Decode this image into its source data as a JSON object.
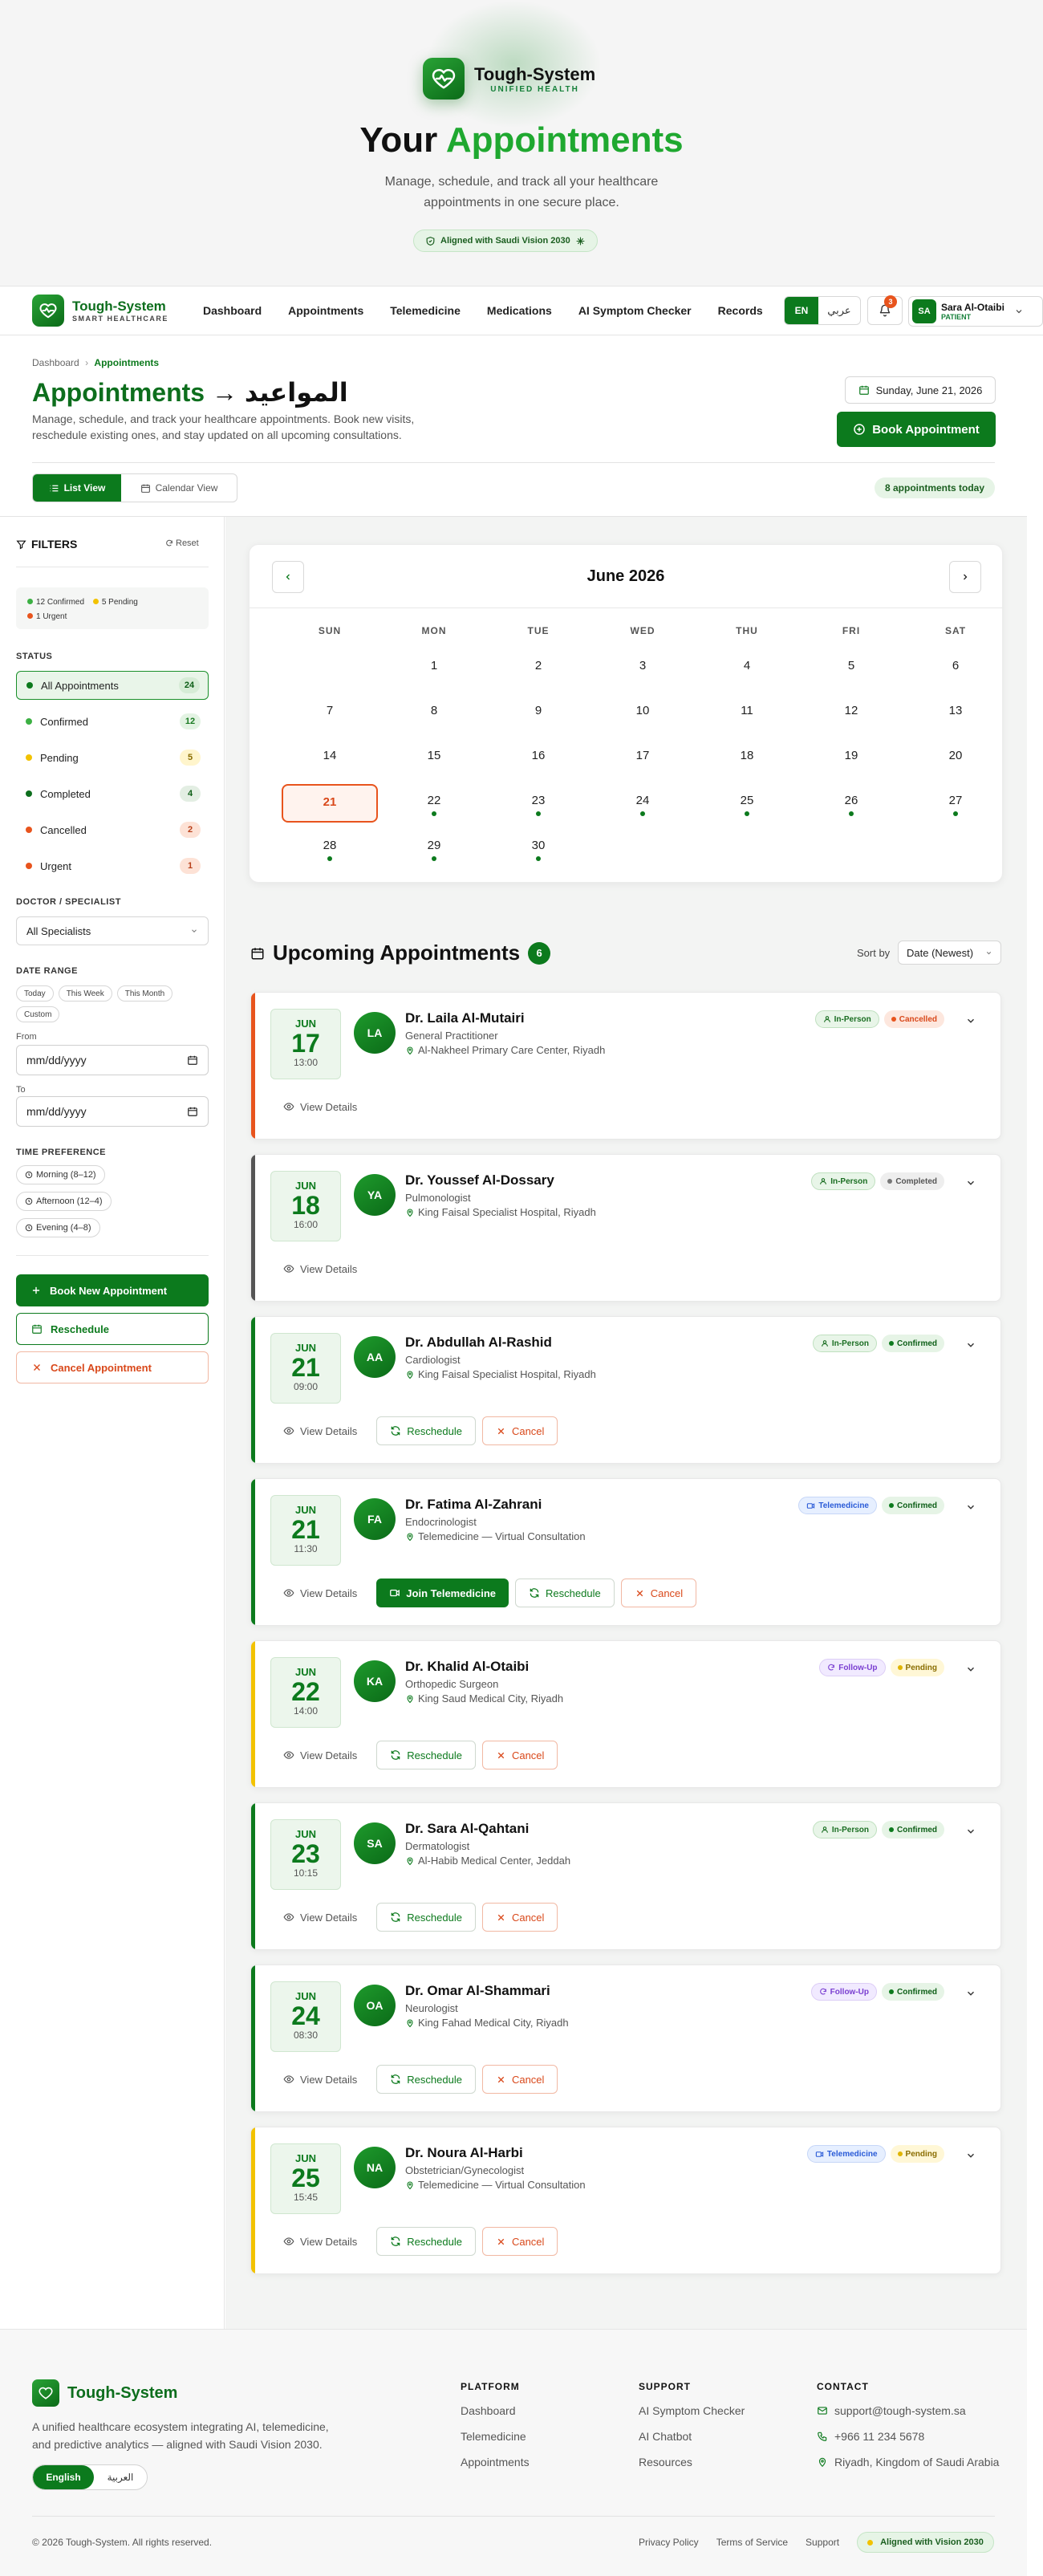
{
  "brand": {
    "name": "Tough-System",
    "tagline_hero": "UNIFIED HEALTH",
    "tagline_nav": "SMART HEALTHCARE",
    "accent": "#0c7a1d"
  },
  "hero": {
    "title_prefix": "Your ",
    "title_accent": "Appointments",
    "subtitle": "Manage, schedule, and track all your healthcare appointments in one secure place.",
    "vision_badge": "Aligned with Saudi Vision 2030"
  },
  "nav": {
    "links": [
      "Dashboard",
      "Appointments",
      "Telemedicine",
      "Medications",
      "AI Symptom Checker",
      "Records"
    ],
    "lang_en": "EN",
    "lang_ar": "عربي",
    "notif_count": "3",
    "user_initials": "SA",
    "user_name": "Sara Al-Otaibi",
    "user_role": "PATIENT"
  },
  "page": {
    "breadcrumb_root": "Dashboard",
    "breadcrumb_current": "Appointments",
    "title_en": "Appointments",
    "title_arrow": " → ",
    "title_ar": "المواعيد",
    "description": "Manage, schedule, and track your healthcare appointments. Book new visits, reschedule existing ones, and stay updated on all upcoming consultations.",
    "current_date": "Sunday, June 21, 2026",
    "book_button": "Book Appointment",
    "view_list": "List View",
    "view_calendar": "Calendar View",
    "today_count": "8 appointments today"
  },
  "sidebar": {
    "title": "FILTERS",
    "reset": "Reset",
    "summary_confirmed": "12 Confirmed",
    "summary_pending": "5 Pending",
    "summary_urgent": "1 Urgent",
    "status_label": "STATUS",
    "statuses": [
      {
        "label": "All Appointments",
        "count": "24",
        "dot": "#0c7a1d",
        "badge_bg": "#d6ecd6",
        "badge_fg": "#0c5e16"
      },
      {
        "label": "Confirmed",
        "count": "12",
        "dot": "#3cb043",
        "badge_bg": "#e3f3e3",
        "badge_fg": "#1a7a22"
      },
      {
        "label": "Pending",
        "count": "5",
        "dot": "#f2c200",
        "badge_bg": "#fff5cc",
        "badge_fg": "#8a6d00"
      },
      {
        "label": "Completed",
        "count": "4",
        "dot": "#0d6e1d",
        "badge_bg": "#e3eee3",
        "badge_fg": "#0d5e16"
      },
      {
        "label": "Cancelled",
        "count": "2",
        "dot": "#e8541d",
        "badge_bg": "#fde2d6",
        "badge_fg": "#b8401a"
      },
      {
        "label": "Urgent",
        "count": "1",
        "dot": "#e8541d",
        "badge_bg": "#fde2d6",
        "badge_fg": "#b8401a"
      }
    ],
    "doctor_label": "DOCTOR / SPECIALIST",
    "doctor_value": "All Specialists",
    "date_range_label": "DATE RANGE",
    "date_chips": [
      "Today",
      "This Week",
      "This Month",
      "Custom"
    ],
    "from_label": "From",
    "to_label": "To",
    "date_placeholder": "mm/dd/yyyy",
    "time_label": "TIME PREFERENCE",
    "time_chips": [
      "Morning (8–12)",
      "Afternoon (12–4)",
      "Evening (4–8)"
    ],
    "btn_book": "Book New Appointment",
    "btn_reschedule": "Reschedule",
    "btn_cancel": "Cancel Appointment"
  },
  "calendar": {
    "title": "June 2026",
    "weekdays": [
      "SUN",
      "MON",
      "TUE",
      "WED",
      "THU",
      "FRI",
      "SAT"
    ],
    "first_weekday": 1,
    "days_in_month": 30,
    "today": 21,
    "appointment_days": [
      22,
      23,
      24,
      25,
      26,
      27,
      28,
      29,
      30
    ]
  },
  "upcoming": {
    "title": "Upcoming Appointments",
    "count": "6",
    "sort_label": "Sort by",
    "sort_value": "Date (Newest)",
    "view_details": "View Details",
    "reschedule": "Reschedule",
    "cancel": "Cancel",
    "join": "Join Telemedicine",
    "items": [
      {
        "month": "JUN",
        "day": "17",
        "time": "13:00",
        "initials": "LA",
        "doctor": "Dr. Laila Al-Mutairi",
        "specialty": "General Practitioner",
        "location": "Al-Nakheel Primary Care Center, Riyadh",
        "type": "In-Person",
        "status": "Cancelled",
        "bar": "#e8541d",
        "actions": [
          "view"
        ]
      },
      {
        "month": "JUN",
        "day": "18",
        "time": "16:00",
        "initials": "YA",
        "doctor": "Dr. Youssef Al-Dossary",
        "specialty": "Pulmonologist",
        "location": "King Faisal Specialist Hospital, Riyadh",
        "type": "In-Person",
        "status": "Completed",
        "bar": "#555555",
        "actions": [
          "view"
        ]
      },
      {
        "month": "JUN",
        "day": "21",
        "time": "09:00",
        "initials": "AA",
        "doctor": "Dr. Abdullah Al-Rashid",
        "specialty": "Cardiologist",
        "location": "King Faisal Specialist Hospital, Riyadh",
        "type": "In-Person",
        "status": "Confirmed",
        "bar": "#0c7a1d",
        "actions": [
          "view",
          "reschedule",
          "cancel"
        ]
      },
      {
        "month": "JUN",
        "day": "21",
        "time": "11:30",
        "initials": "FA",
        "doctor": "Dr. Fatima Al-Zahrani",
        "specialty": "Endocrinologist",
        "location": "Telemedicine — Virtual Consultation",
        "type": "Telemedicine",
        "status": "Confirmed",
        "bar": "#0c7a1d",
        "actions": [
          "view",
          "join",
          "reschedule",
          "cancel"
        ]
      },
      {
        "month": "JUN",
        "day": "22",
        "time": "14:00",
        "initials": "KA",
        "doctor": "Dr. Khalid Al-Otaibi",
        "specialty": "Orthopedic Surgeon",
        "location": "King Saud Medical City, Riyadh",
        "type": "Follow-Up",
        "status": "Pending",
        "bar": "#f2c200",
        "actions": [
          "view",
          "reschedule",
          "cancel"
        ]
      },
      {
        "month": "JUN",
        "day": "23",
        "time": "10:15",
        "initials": "SA",
        "doctor": "Dr. Sara Al-Qahtani",
        "specialty": "Dermatologist",
        "location": "Al-Habib Medical Center, Jeddah",
        "type": "In-Person",
        "status": "Confirmed",
        "bar": "#0c7a1d",
        "actions": [
          "view",
          "reschedule",
          "cancel"
        ]
      },
      {
        "month": "JUN",
        "day": "24",
        "time": "08:30",
        "initials": "OA",
        "doctor": "Dr. Omar Al-Shammari",
        "specialty": "Neurologist",
        "location": "King Fahad Medical City, Riyadh",
        "type": "Follow-Up",
        "status": "Confirmed",
        "bar": "#0c7a1d",
        "actions": [
          "view",
          "reschedule",
          "cancel"
        ]
      },
      {
        "month": "JUN",
        "day": "25",
        "time": "15:45",
        "initials": "NA",
        "doctor": "Dr. Noura Al-Harbi",
        "specialty": "Obstetrician/Gynecologist",
        "location": "Telemedicine — Virtual Consultation",
        "type": "Telemedicine",
        "status": "Pending",
        "bar": "#f2c200",
        "actions": [
          "view",
          "reschedule",
          "cancel"
        ]
      }
    ]
  },
  "footer": {
    "name": "Tough-System",
    "description": "A unified healthcare ecosystem integrating AI, telemedicine, and predictive analytics — aligned with Saudi Vision 2030.",
    "lang_en": "English",
    "lang_ar": "العربية",
    "platform_title": "PLATFORM",
    "platform_links": [
      "Dashboard",
      "Telemedicine",
      "Appointments"
    ],
    "support_title": "SUPPORT",
    "support_links": [
      "AI Symptom Checker",
      "AI Chatbot",
      "Resources"
    ],
    "contact_title": "CONTACT",
    "contact_email": "support@tough-system.sa",
    "contact_phone": "+966 11 234 5678",
    "contact_address": "Riyadh, Kingdom of Saudi Arabia",
    "copyright": "© 2026 Tough-System. All rights reserved.",
    "privacy": "Privacy Policy",
    "terms": "Terms of Service",
    "support": "Support",
    "vision": "Aligned with Vision 2030"
  }
}
